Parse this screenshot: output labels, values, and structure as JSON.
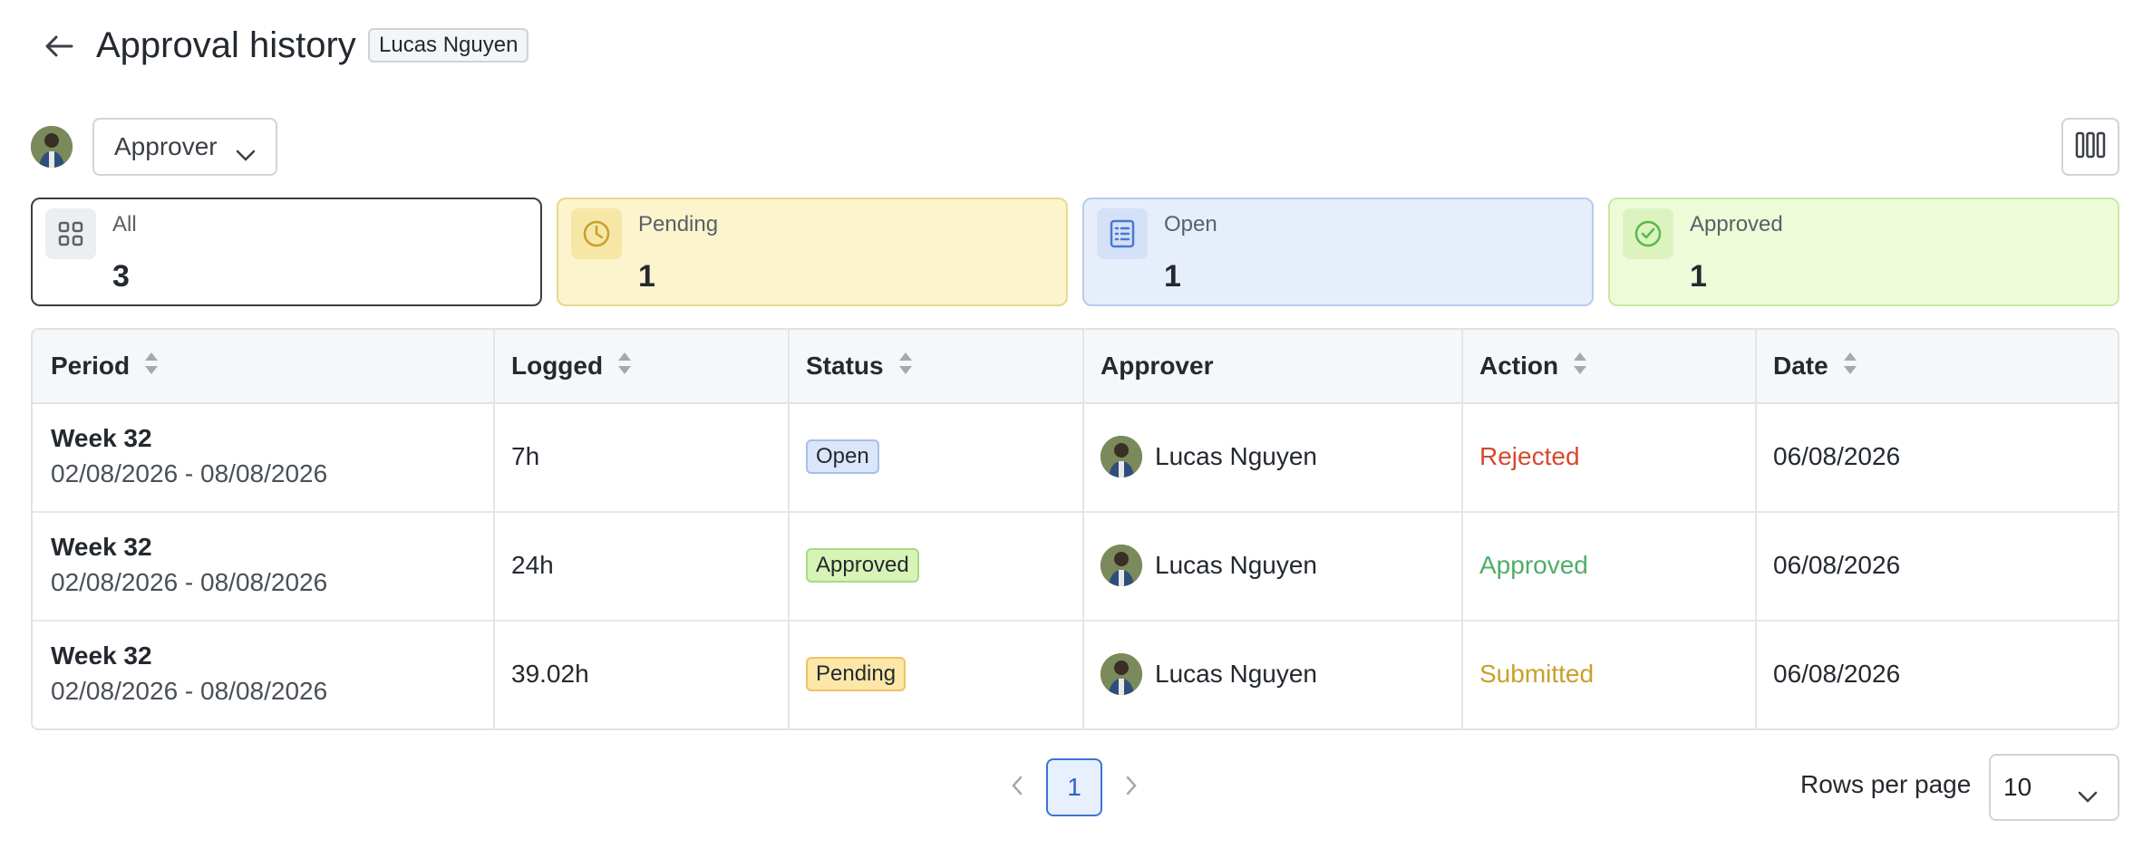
{
  "header": {
    "title": "Approval history",
    "user_chip": "Lucas Nguyen",
    "back_icon": "arrow-left-icon"
  },
  "toolbar": {
    "approver_label": "Approver",
    "columns_icon": "columns-icon"
  },
  "cards": [
    {
      "label": "All",
      "count": "3",
      "icon": "grid-icon",
      "bg": "#ffffff",
      "border": "#3a3f45",
      "icon_bg": "#eceef0"
    },
    {
      "label": "Pending",
      "count": "1",
      "icon": "clock-icon",
      "bg": "#fbf4cc",
      "border": "#e8d98a",
      "icon_bg": "#f6e7a6"
    },
    {
      "label": "Open",
      "count": "1",
      "icon": "list-icon",
      "bg": "#e6eefb",
      "border": "#b8caef",
      "icon_bg": "#d5e1f7"
    },
    {
      "label": "Approved",
      "count": "1",
      "icon": "check-circle-icon",
      "bg": "#eefbd9",
      "border": "#c9e8a4",
      "icon_bg": "#dcf3c0"
    }
  ],
  "table": {
    "columns": [
      {
        "label": "Period",
        "sortable": true
      },
      {
        "label": "Logged",
        "sortable": true
      },
      {
        "label": "Status",
        "sortable": true
      },
      {
        "label": "Approver",
        "sortable": false
      },
      {
        "label": "Action",
        "sortable": true
      },
      {
        "label": "Date",
        "sortable": true
      }
    ],
    "rows": [
      {
        "period_name": "Week 32",
        "period_range": "02/08/2026 - 08/08/2026",
        "logged": "7h",
        "status": "Open",
        "approver": "Lucas Nguyen",
        "action": "Rejected",
        "date": "06/08/2026"
      },
      {
        "period_name": "Week 32",
        "period_range": "02/08/2026 - 08/08/2026",
        "logged": "24h",
        "status": "Approved",
        "approver": "Lucas Nguyen",
        "action": "Approved",
        "date": "06/08/2026"
      },
      {
        "period_name": "Week 32",
        "period_range": "02/08/2026 - 08/08/2026",
        "logged": "39.02h",
        "status": "Pending",
        "approver": "Lucas Nguyen",
        "action": "Submitted",
        "date": "06/08/2026"
      }
    ]
  },
  "pagination": {
    "current_page": "1",
    "rows_per_page_label": "Rows per page",
    "rows_per_page_value": "10"
  },
  "colors": {
    "action_rejected": "#d6492e",
    "action_approved": "#4fae66",
    "action_submitted": "#c9a02a",
    "accent": "#3b73d8"
  }
}
